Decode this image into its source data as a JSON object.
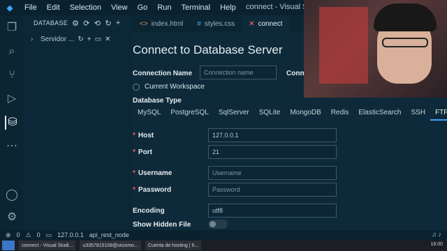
{
  "titlebar": {
    "menu": [
      "File",
      "Edit",
      "Selection",
      "View",
      "Go",
      "Run",
      "Terminal",
      "Help"
    ],
    "window_title": "connect - Visual Studi"
  },
  "sidebar": {
    "header": "DATABASE",
    "connection": "Servidor ..."
  },
  "tabs": [
    {
      "icon": "<>",
      "label": "index.html"
    },
    {
      "icon": "#",
      "label": "styles.css"
    },
    {
      "icon": "✕",
      "label": "connect"
    }
  ],
  "form": {
    "title": "Connect to Database Server",
    "connection_name_label": "Connection Name",
    "connection_name_placeholder": "Connection name",
    "connection_label_cut": "Conne",
    "current_workspace": "Current Workspace",
    "db_type_label": "Database Type",
    "db_types": [
      "MySQL",
      "PostgreSQL",
      "SqlServer",
      "SQLite",
      "MongoDB",
      "Redis",
      "ElasticSearch",
      "SSH",
      "FTP"
    ],
    "active_db_type": "FTP",
    "host_label": "Host",
    "host_value": "127.0.0.1",
    "port_label": "Port",
    "port_value": "21",
    "username_label": "Username",
    "username_placeholder": "Username",
    "password_label": "Password",
    "password_placeholder": "Password",
    "encoding_label": "Encoding",
    "encoding_value": "utf8",
    "show_hidden_label": "Show Hidden File"
  },
  "statusbar": {
    "errors": "0",
    "warnings": "0",
    "host": "127.0.0.1",
    "db": "api_rest_node"
  },
  "taskbar": {
    "tasks": [
      "connect - Visual Studi...",
      "u3357815108@viciomo...",
      "Cuenta de hosting | h..."
    ],
    "clock": "16:00"
  }
}
